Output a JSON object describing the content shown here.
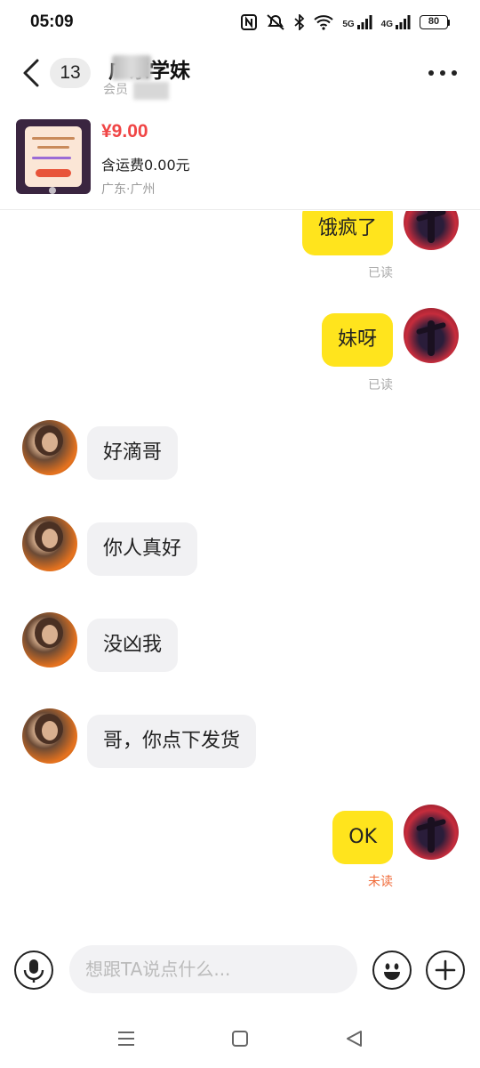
{
  "status_bar": {
    "time": "05:09",
    "battery": "80",
    "network_1": "5G",
    "network_2": "4G"
  },
  "header": {
    "unread_count": "13",
    "name": "广东学妹",
    "subtitle": "会员"
  },
  "product": {
    "price": "¥9.00",
    "shipping": "含运费0.00元",
    "location": "广东·广州"
  },
  "messages": [
    {
      "from": "me",
      "text": "饿疯了",
      "status": "已读"
    },
    {
      "from": "me",
      "text": "妹呀",
      "status": "已读"
    },
    {
      "from": "them",
      "text": "好滴哥"
    },
    {
      "from": "them",
      "text": "你人真好"
    },
    {
      "from": "them",
      "text": "没凶我"
    },
    {
      "from": "them",
      "text": "哥，你点下发货"
    },
    {
      "from": "me",
      "text": "OK",
      "status": "未读"
    }
  ],
  "input": {
    "placeholder": "想跟TA说点什么..."
  },
  "colors": {
    "my_bubble": "#ffe41d",
    "their_bubble": "#f1f1f3",
    "price": "#f04545",
    "unread_status": "#f06b3a"
  },
  "icons": [
    "back-icon",
    "more-icon",
    "microphone-icon",
    "emoji-icon",
    "plus-icon",
    "menu-icon",
    "home-icon",
    "back-triangle-icon",
    "nfc-icon",
    "mute-icon",
    "bluetooth-icon",
    "wifi-icon",
    "signal-icon",
    "battery-icon"
  ]
}
